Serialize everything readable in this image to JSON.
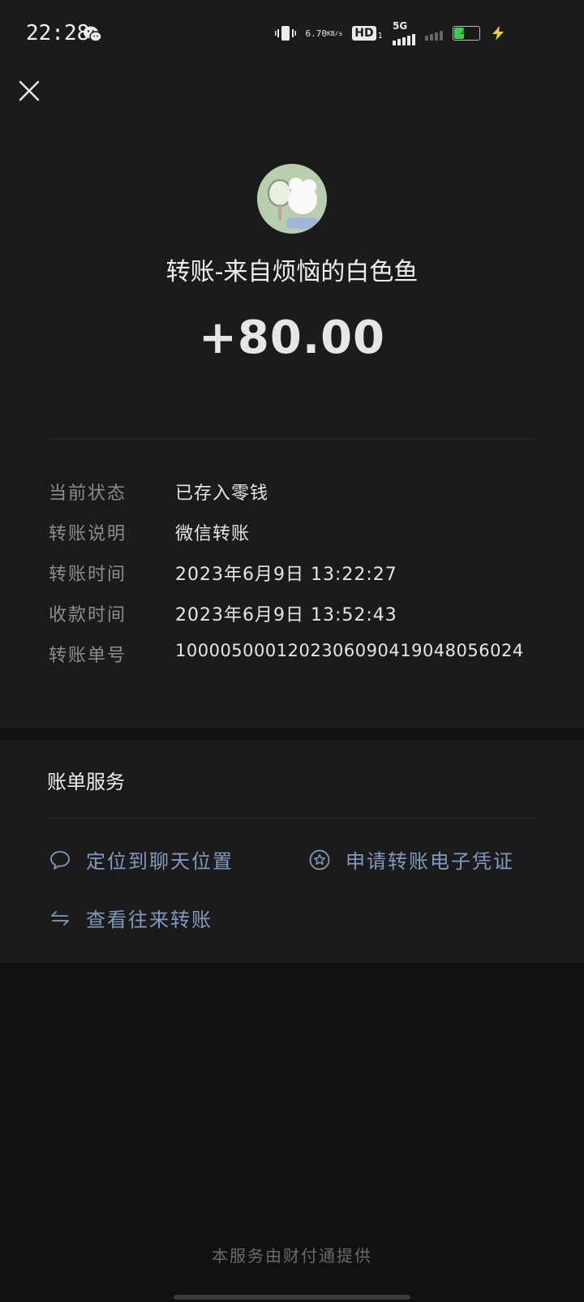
{
  "status_bar": {
    "time": "22:28",
    "net_speed_value": "6.70",
    "net_speed_unit": "KB/s",
    "hd_label": "HD",
    "hd_sub": "1",
    "network_label": "5G",
    "battery_percent": "41",
    "battery_level": 0.41,
    "colors": {
      "battery_fill": "#3ccf4e",
      "charge": "#f2d21b"
    },
    "icons": [
      "wechat-icon",
      "vibrate-icon",
      "signal-icon",
      "battery-icon",
      "charging-icon"
    ]
  },
  "header": {
    "close_icon": "close-icon"
  },
  "transfer": {
    "title": "转账-来自烦恼的白色鱼",
    "amount": "+80.00"
  },
  "details": [
    {
      "label": "当前状态",
      "value": "已存入零钱"
    },
    {
      "label": "转账说明",
      "value": "微信转账"
    },
    {
      "label": "转账时间",
      "value": "2023年6月9日 13:22:27"
    },
    {
      "label": "收款时间",
      "value": "2023年6月9日 13:52:43"
    },
    {
      "label": "转账单号",
      "value": "1000050001202306090419048056024"
    }
  ],
  "services": {
    "title": "账单服务",
    "items": [
      {
        "label": "定位到聊天位置",
        "icon": "chat-bubble-icon"
      },
      {
        "label": "申请转账电子凭证",
        "icon": "star-circle-icon"
      },
      {
        "label": "查看往来转账",
        "icon": "exchange-arrows-icon"
      }
    ],
    "link_color": "#7f9bbf"
  },
  "footer": {
    "text": "本服务由财付通提供"
  }
}
